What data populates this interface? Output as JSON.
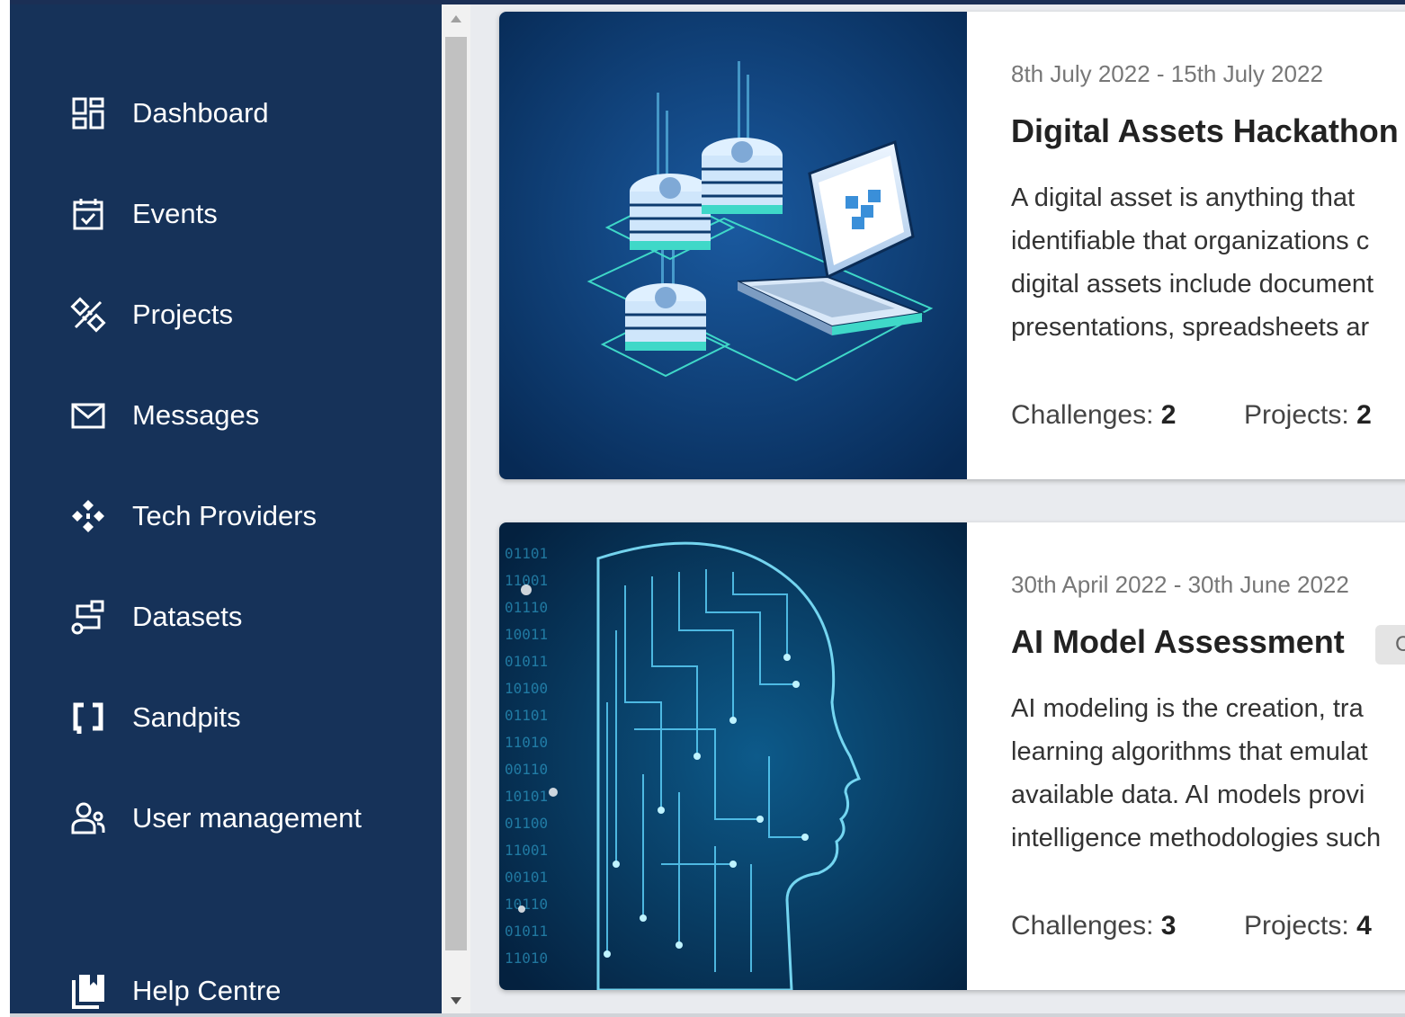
{
  "sidebar": {
    "items": [
      {
        "label": "Dashboard",
        "icon": "dashboard-icon"
      },
      {
        "label": "Events",
        "icon": "calendar-check-icon"
      },
      {
        "label": "Projects",
        "icon": "design-tools-icon"
      },
      {
        "label": "Messages",
        "icon": "envelope-icon"
      },
      {
        "label": "Tech Providers",
        "icon": "network-nodes-icon"
      },
      {
        "label": "Datasets",
        "icon": "dataset-flow-icon"
      },
      {
        "label": "Sandpits",
        "icon": "brackets-icon"
      },
      {
        "label": "User management",
        "icon": "users-icon"
      }
    ],
    "help": {
      "label": "Help Centre",
      "icon": "book-icon"
    }
  },
  "events": [
    {
      "date": "8th July 2022 - 15th July 2022",
      "title": "Digital Assets Hackathon",
      "description": [
        " A digital asset is anything that",
        "identifiable that organizations c",
        "digital assets include document",
        "presentations, spreadsheets ar"
      ],
      "challenges_label": "Challenges:",
      "challenges": "2",
      "projects_label": "Projects:",
      "projects": "2",
      "image": "digital-assets-illustration"
    },
    {
      "date": "30th April 2022 - 30th June 2022",
      "title": "AI Model Assessment",
      "badge": "C",
      "description": [
        " AI modeling is the creation, tra",
        "learning algorithms that emulat",
        "available data. AI models provi",
        "intelligence methodologies such"
      ],
      "challenges_label": "Challenges:",
      "challenges": "3",
      "projects_label": "Projects:",
      "projects": "4",
      "image": "ai-head-illustration"
    }
  ],
  "colors": {
    "sidebar_bg": "#163259",
    "card_image_bg": "#0a3a6c",
    "accent_teal": "#3fd8c8"
  }
}
